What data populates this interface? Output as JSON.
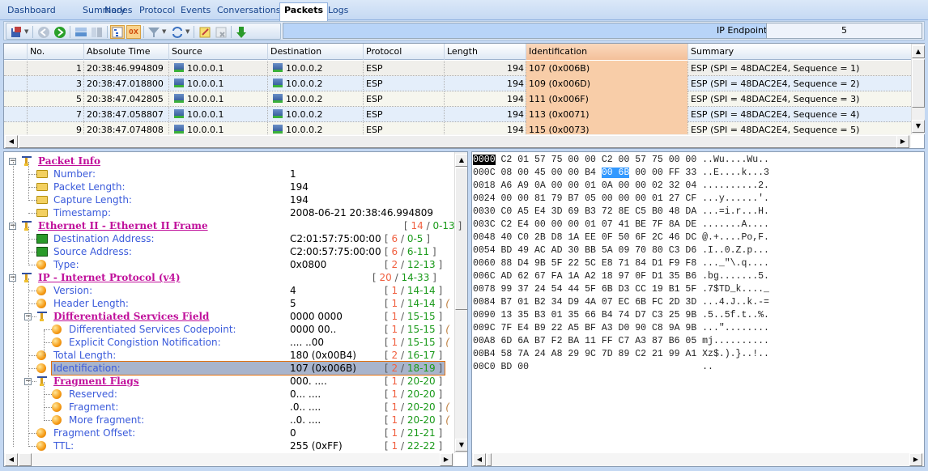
{
  "tabs": [
    {
      "label": "Dashboard",
      "active": false
    },
    {
      "label": "Summary",
      "active": false
    },
    {
      "label": "Nodes",
      "active": false
    },
    {
      "label": "Protocol",
      "active": false
    },
    {
      "label": "Events",
      "active": false
    },
    {
      "label": "Conversations",
      "active": false
    },
    {
      "label": "Packets",
      "active": true
    },
    {
      "label": "Logs",
      "active": false
    }
  ],
  "toolbar": {
    "icons": [
      "save-export-icon",
      "back-icon",
      "forward-icon",
      "horizontal-layout-icon",
      "vertical-layout-icon",
      "tree-view-icon",
      "hex-view-icon",
      "filter-icon",
      "refresh-icon",
      "edit-note-icon",
      "clear-icon",
      "download-icon"
    ],
    "hex_label": "0X",
    "ip_endpoint_label": "IP Endpoint",
    "ip_endpoint_value": "5"
  },
  "packet_grid": {
    "columns": [
      "No.",
      "Absolute Time",
      "Source",
      "Destination",
      "Protocol",
      "Length",
      "Identification",
      "Summary"
    ],
    "rows": [
      {
        "no": "1",
        "time": "20:38:46.994809",
        "source": "10.0.0.1",
        "destination": "10.0.0.2",
        "protocol": "ESP",
        "length": "194",
        "identification": "107 (0x006B)",
        "summary": "ESP (SPI = 48DAC2E4, Sequence = 1)"
      },
      {
        "no": "3",
        "time": "20:38:47.018800",
        "source": "10.0.0.1",
        "destination": "10.0.0.2",
        "protocol": "ESP",
        "length": "194",
        "identification": "109 (0x006D)",
        "summary": "ESP (SPI = 48DAC2E4, Sequence = 2)"
      },
      {
        "no": "5",
        "time": "20:38:47.042805",
        "source": "10.0.0.1",
        "destination": "10.0.0.2",
        "protocol": "ESP",
        "length": "194",
        "identification": "111 (0x006F)",
        "summary": "ESP (SPI = 48DAC2E4, Sequence = 3)"
      },
      {
        "no": "7",
        "time": "20:38:47.058807",
        "source": "10.0.0.1",
        "destination": "10.0.0.2",
        "protocol": "ESP",
        "length": "194",
        "identification": "113 (0x0071)",
        "summary": "ESP (SPI = 48DAC2E4, Sequence = 4)"
      },
      {
        "no": "9",
        "time": "20:38:47.074808",
        "source": "10.0.0.1",
        "destination": "10.0.0.2",
        "protocol": "ESP",
        "length": "194",
        "identification": "115 (0x0073)",
        "summary": "ESP (SPI = 48DAC2E4, Sequence = 5)"
      }
    ]
  },
  "decode_tree": [
    {
      "level": 0,
      "type": "group",
      "name": "Packet Info",
      "value": "",
      "size": "",
      "range": ""
    },
    {
      "level": 1,
      "type": "note",
      "name": "Number:",
      "value": "1",
      "size": "",
      "range": ""
    },
    {
      "level": 1,
      "type": "note",
      "name": "Packet Length:",
      "value": "194",
      "size": "",
      "range": ""
    },
    {
      "level": 1,
      "type": "note",
      "name": "Capture Length:",
      "value": "194",
      "size": "",
      "range": ""
    },
    {
      "level": 1,
      "type": "note",
      "name": "Timestamp:",
      "value": "2008-06-21 20:38:46.994809",
      "size": "",
      "range": ""
    },
    {
      "level": 0,
      "type": "group",
      "name": "Ethernet II - Ethernet II Frame",
      "value": "",
      "size": "14",
      "range": "0-13",
      "range_pos": "far"
    },
    {
      "level": 1,
      "type": "net",
      "name": "Destination Address:",
      "value": "C2:01:57:75:00:00",
      "size": "6",
      "range": "0-5"
    },
    {
      "level": 1,
      "type": "net",
      "name": "Source Address:",
      "value": "C2:00:57:75:00:00",
      "size": "6",
      "range": "6-11"
    },
    {
      "level": 1,
      "type": "ball",
      "name": "Type:",
      "value": "0x0800",
      "size": "2",
      "range": "12-13"
    },
    {
      "level": 0,
      "type": "group",
      "name": "IP - Internet Protocol (v4)",
      "value": "",
      "size": "20",
      "range": "14-33",
      "range_pos": "mid"
    },
    {
      "level": 1,
      "type": "ball",
      "name": "Version:",
      "value": "4",
      "size": "1",
      "range": "14-14"
    },
    {
      "level": 1,
      "type": "ball",
      "name": "Header Length:",
      "value": "5",
      "size": "1",
      "range": "14-14",
      "extra": "("
    },
    {
      "level": 1,
      "type": "group",
      "name": "Differentiated Services Field",
      "value": "0000 0000",
      "size": "1",
      "range": "15-15"
    },
    {
      "level": 2,
      "type": "ball",
      "name": "Differentiated Services Codepoint:",
      "value": "0000 00..",
      "size": "1",
      "range": "15-15",
      "extra": "("
    },
    {
      "level": 2,
      "type": "ball",
      "name": "Explicit Congistion Notification:",
      "value": ".... ..00",
      "size": "1",
      "range": "15-15",
      "extra": "("
    },
    {
      "level": 1,
      "type": "ball",
      "name": "Total Length:",
      "value": "180 (0x00B4)",
      "size": "2",
      "range": "16-17"
    },
    {
      "level": 1,
      "type": "ball",
      "name": "Identification:",
      "value": "107 (0x006B)",
      "size": "2",
      "range": "18-19",
      "selected": true
    },
    {
      "level": 1,
      "type": "group",
      "name": "Fragment Flags",
      "value": "000. ....",
      "size": "1",
      "range": "20-20"
    },
    {
      "level": 2,
      "type": "ball",
      "name": "Reserved:",
      "value": "0... ....",
      "size": "1",
      "range": "20-20"
    },
    {
      "level": 2,
      "type": "ball",
      "name": "Fragment:",
      "value": ".0.. ....",
      "size": "1",
      "range": "20-20",
      "extra": "("
    },
    {
      "level": 2,
      "type": "ball",
      "name": "More fragment:",
      "value": "..0. ....",
      "size": "1",
      "range": "20-20",
      "extra": "("
    },
    {
      "level": 1,
      "type": "ball",
      "name": "Fragment Offset:",
      "value": "0",
      "size": "1",
      "range": "21-21"
    },
    {
      "level": 1,
      "type": "ball",
      "name": "TTL:",
      "value": "255 (0xFF)",
      "size": "1",
      "range": "22-22"
    }
  ],
  "hex_dump": [
    {
      "offset": "0000",
      "bytes": [
        "C2",
        "01",
        "57",
        "75",
        "00",
        "00",
        "C2",
        "00",
        "57",
        "75",
        "00",
        "00"
      ],
      "ascii": "..Wu....Wu.."
    },
    {
      "offset": "000C",
      "bytes": [
        "08",
        "00",
        "45",
        "00",
        "00",
        "B4",
        "00",
        "6B",
        "00",
        "00",
        "FF",
        "33"
      ],
      "ascii": "..E....k...3"
    },
    {
      "offset": "0018",
      "bytes": [
        "A6",
        "A9",
        "0A",
        "00",
        "00",
        "01",
        "0A",
        "00",
        "00",
        "02",
        "32",
        "04"
      ],
      "ascii": "..........2."
    },
    {
      "offset": "0024",
      "bytes": [
        "00",
        "00",
        "81",
        "79",
        "B7",
        "05",
        "00",
        "00",
        "00",
        "01",
        "27",
        "CF"
      ],
      "ascii": "...y......'."
    },
    {
      "offset": "0030",
      "bytes": [
        "C0",
        "A5",
        "E4",
        "3D",
        "69",
        "B3",
        "72",
        "8E",
        "C5",
        "B0",
        "48",
        "DA"
      ],
      "ascii": "...=i.r...H."
    },
    {
      "offset": "003C",
      "bytes": [
        "C2",
        "E4",
        "00",
        "00",
        "00",
        "01",
        "07",
        "41",
        "BE",
        "7F",
        "8A",
        "DE"
      ],
      "ascii": ".......A...."
    },
    {
      "offset": "0048",
      "bytes": [
        "40",
        "C0",
        "2B",
        "D8",
        "1A",
        "EE",
        "0F",
        "50",
        "6F",
        "2C",
        "46",
        "DC"
      ],
      "ascii": "@.+....Po,F."
    },
    {
      "offset": "0054",
      "bytes": [
        "BD",
        "49",
        "AC",
        "AD",
        "30",
        "BB",
        "5A",
        "09",
        "70",
        "80",
        "C3",
        "D6"
      ],
      "ascii": ".I..0.Z.p..."
    },
    {
      "offset": "0060",
      "bytes": [
        "88",
        "D4",
        "9B",
        "5F",
        "22",
        "5C",
        "E8",
        "71",
        "84",
        "D1",
        "F9",
        "F8"
      ],
      "ascii": "..._\"\\.q...."
    },
    {
      "offset": "006C",
      "bytes": [
        "AD",
        "62",
        "67",
        "FA",
        "1A",
        "A2",
        "18",
        "97",
        "0F",
        "D1",
        "35",
        "B6"
      ],
      "ascii": ".bg.......5."
    },
    {
      "offset": "0078",
      "bytes": [
        "99",
        "37",
        "24",
        "54",
        "44",
        "5F",
        "6B",
        "D3",
        "CC",
        "19",
        "B1",
        "5F"
      ],
      "ascii": ".7$TD_k...._"
    },
    {
      "offset": "0084",
      "bytes": [
        "B7",
        "01",
        "B2",
        "34",
        "D9",
        "4A",
        "07",
        "EC",
        "6B",
        "FC",
        "2D",
        "3D"
      ],
      "ascii": "...4.J..k.-="
    },
    {
      "offset": "0090",
      "bytes": [
        "13",
        "35",
        "B3",
        "01",
        "35",
        "66",
        "B4",
        "74",
        "D7",
        "C3",
        "25",
        "9B"
      ],
      "ascii": ".5..5f.t..%."
    },
    {
      "offset": "009C",
      "bytes": [
        "7F",
        "E4",
        "B9",
        "22",
        "A5",
        "BF",
        "A3",
        "D0",
        "90",
        "C8",
        "9A",
        "9B"
      ],
      "ascii": "...\"........"
    },
    {
      "offset": "00A8",
      "bytes": [
        "6D",
        "6A",
        "B7",
        "F2",
        "BA",
        "11",
        "FF",
        "C7",
        "A3",
        "87",
        "B6",
        "05"
      ],
      "ascii": "mj.........."
    },
    {
      "offset": "00B4",
      "bytes": [
        "58",
        "7A",
        "24",
        "A8",
        "29",
        "9C",
        "7D",
        "89",
        "C2",
        "21",
        "99",
        "A1"
      ],
      "ascii": "Xz$.).}..!.."
    },
    {
      "offset": "00C0",
      "bytes": [
        "BD",
        "00"
      ],
      "ascii": ".."
    }
  ],
  "hex_selection": {
    "row": 1,
    "start": 6,
    "end": 7
  }
}
